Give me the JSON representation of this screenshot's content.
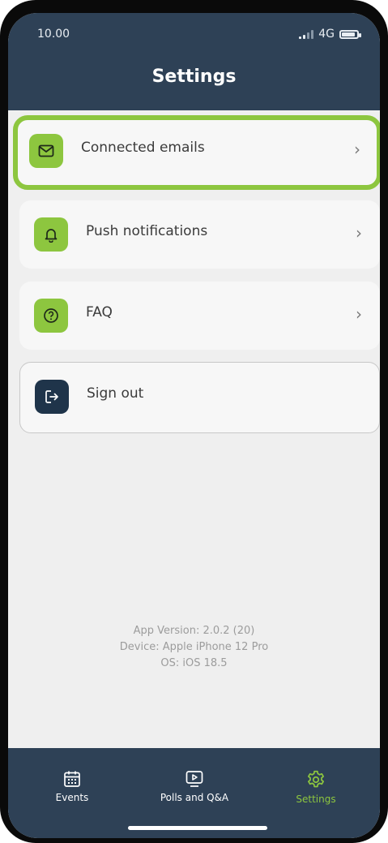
{
  "status_bar": {
    "time": "10.00",
    "network": "4G"
  },
  "header": {
    "title": "Settings"
  },
  "settings_items": [
    {
      "label": "Connected emails",
      "icon": "mail-icon",
      "selected": true
    },
    {
      "label": "Push notifications",
      "icon": "bell-icon"
    },
    {
      "label": "FAQ",
      "icon": "question-circle-icon"
    },
    {
      "label": "Sign out",
      "icon": "sign-out-icon"
    }
  ],
  "app_info": {
    "version": "App Version: 2.0.2 (20)",
    "device": "Device: Apple iPhone 12 Pro",
    "os": "OS: iOS 18.5"
  },
  "tabs": [
    {
      "label": "Events",
      "icon": "calendar-icon"
    },
    {
      "label": "Polls and Q&A",
      "icon": "play-screen-icon"
    },
    {
      "label": "Settings",
      "icon": "gear-icon",
      "active": true
    }
  ],
  "colors": {
    "header": "#2e4156",
    "accent": "#8dc63f",
    "dark_icon": "#1f344a",
    "background": "#efefef"
  }
}
